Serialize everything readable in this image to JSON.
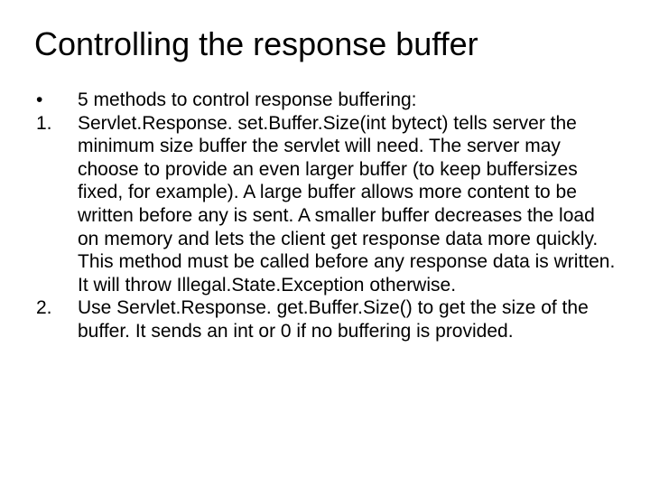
{
  "title": "Controlling the response buffer",
  "items": [
    {
      "marker": "•",
      "text": "5 methods to control response buffering:"
    },
    {
      "marker": "1.",
      "text": "Servlet.Response. set.Buffer.Size(int bytect) tells server the minimum size buffer the servlet will need.  The server may choose to provide an even larger buffer (to keep buffersizes fixed, for example).  A large buffer allows more content to be written before any is sent.  A smaller buffer decreases the load on memory and lets the client get response data more quickly. This method must be called before any response data is written.  It will throw Illegal.State.Exception otherwise."
    },
    {
      "marker": "2.",
      "text": "Use Servlet.Response. get.Buffer.Size() to get the size of the buffer.  It sends an int or 0 if no buffering is provided."
    }
  ]
}
